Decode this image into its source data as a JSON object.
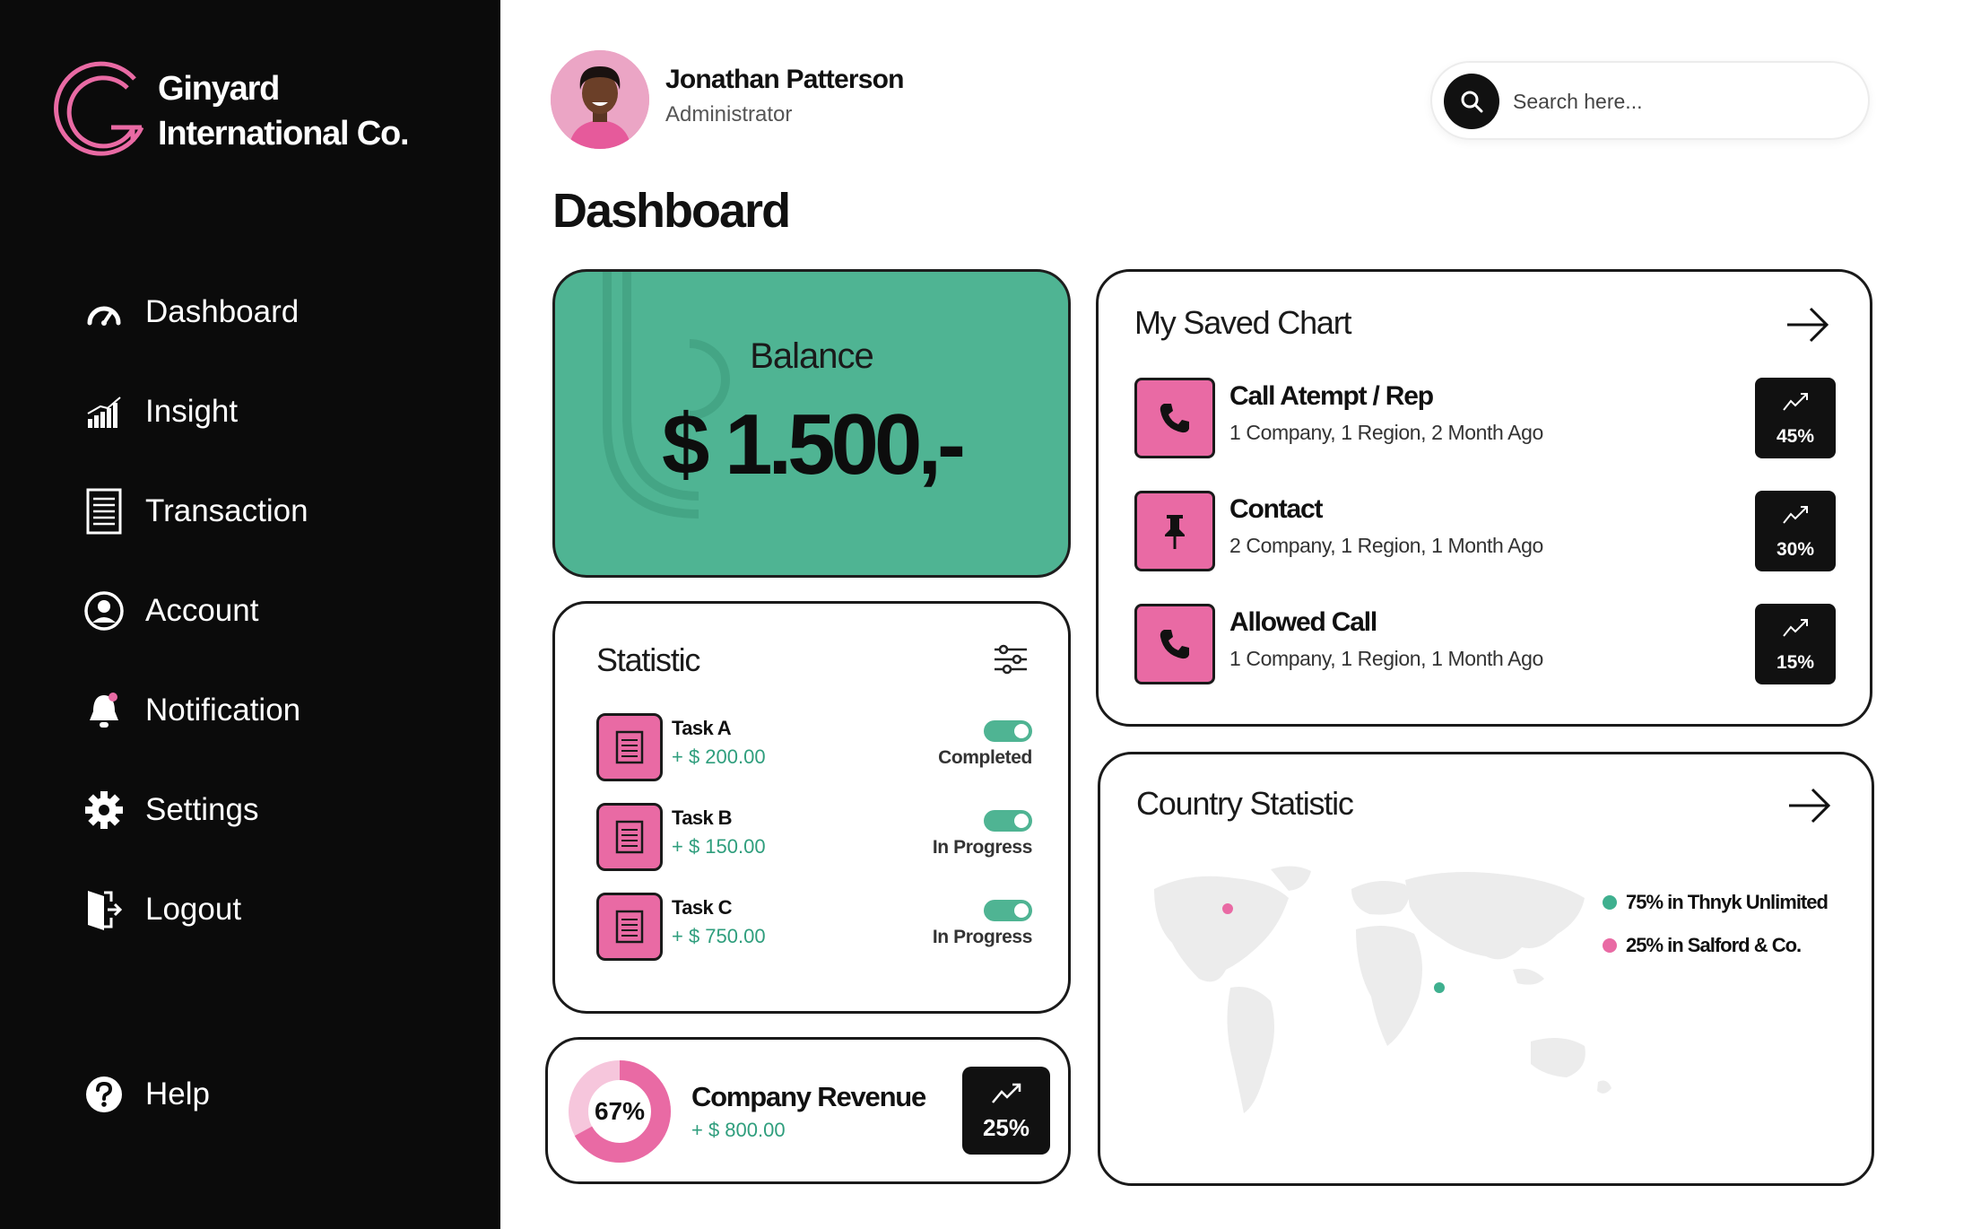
{
  "brand": {
    "line1": "Ginyard",
    "line2": "International Co."
  },
  "nav": {
    "items": [
      {
        "label": "Dashboard",
        "icon": "speedometer-icon"
      },
      {
        "label": "Insight",
        "icon": "signal-bars-icon"
      },
      {
        "label": "Transaction",
        "icon": "document-icon"
      },
      {
        "label": "Account",
        "icon": "user-circle-icon"
      },
      {
        "label": "Notification",
        "icon": "bell-icon"
      },
      {
        "label": "Settings",
        "icon": "gear-icon"
      },
      {
        "label": "Logout",
        "icon": "door-exit-icon"
      }
    ],
    "help": "Help"
  },
  "user": {
    "name": "Jonathan Patterson",
    "role": "Administrator"
  },
  "search": {
    "placeholder": "Search here..."
  },
  "page": {
    "title": "Dashboard"
  },
  "balance": {
    "label": "Balance",
    "value": "$ 1.500,-"
  },
  "statistic": {
    "title": "Statistic",
    "tasks": [
      {
        "name": "Task A",
        "amount": "+ $ 200.00",
        "status": "Completed"
      },
      {
        "name": "Task B",
        "amount": "+ $ 150.00",
        "status": "In Progress"
      },
      {
        "name": "Task C",
        "amount": "+ $ 750.00",
        "status": "In Progress"
      }
    ]
  },
  "revenue": {
    "percent": "67%",
    "percent_value": 0.67,
    "title": "Company Revenue",
    "amount": "+ $ 800.00",
    "growth": "25%"
  },
  "saved_chart": {
    "title": "My Saved Chart",
    "items": [
      {
        "title": "Call Atempt / Rep",
        "subtitle": "1 Company, 1 Region, 2 Month Ago",
        "percent": "45%",
        "icon": "phone-icon"
      },
      {
        "title": "Contact",
        "subtitle": "2 Company, 1 Region, 1 Month Ago",
        "percent": "30%",
        "icon": "pin-icon"
      },
      {
        "title": "Allowed Call",
        "subtitle": "1 Company, 1 Region, 1 Month Ago",
        "percent": "15%",
        "icon": "phone-icon"
      }
    ]
  },
  "country": {
    "title": "Country Statistic",
    "legend": [
      {
        "label": "75% in Thnyk Unlimited",
        "color": "#3fb08f"
      },
      {
        "label": "25% in Salford & Co.",
        "color": "#e96aa4"
      }
    ]
  },
  "colors": {
    "accent_pink": "#e96aa4",
    "accent_green": "#4fb493",
    "dark": "#0b0b0b"
  }
}
